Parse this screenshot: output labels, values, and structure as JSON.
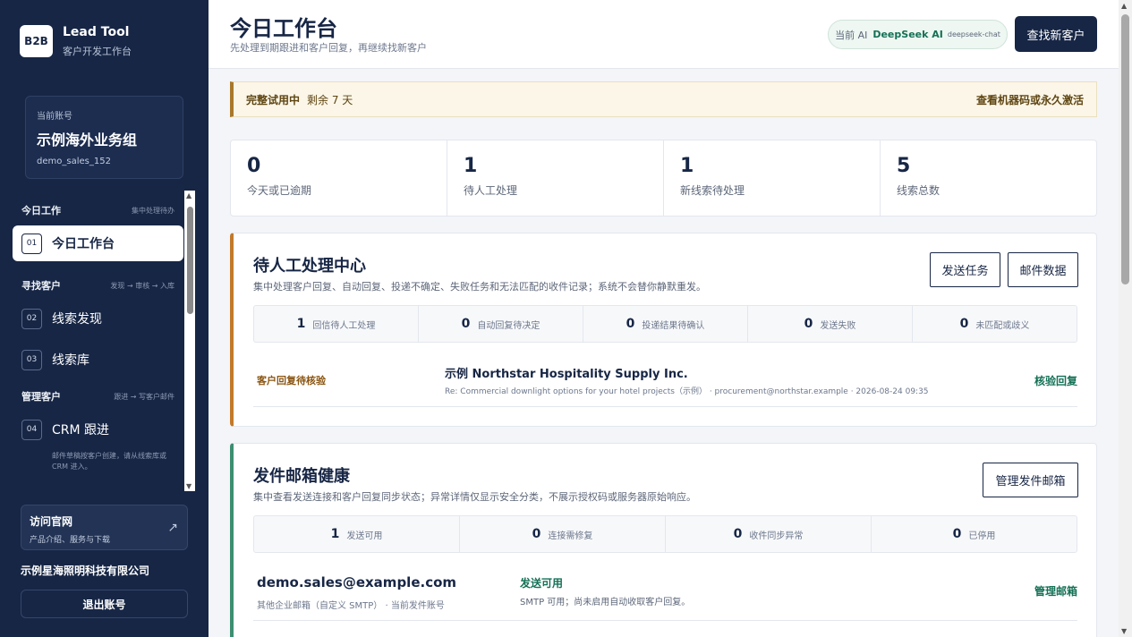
{
  "brand": {
    "logo": "B2B",
    "name": "Lead Tool",
    "subtitle": "客户开发工作台"
  },
  "account": {
    "label": "当前账号",
    "name": "示例海外业务组",
    "id": "demo_sales_152"
  },
  "nav": {
    "groups": [
      {
        "title": "今日工作",
        "hint": "集中处理待办"
      },
      {
        "title": "寻找客户",
        "hint": "发现 → 审核 → 入库"
      },
      {
        "title": "管理客户",
        "hint": "跟进 → 写客户邮件"
      }
    ],
    "items": [
      {
        "num": "01",
        "label": "今日工作台"
      },
      {
        "num": "02",
        "label": "线索发现"
      },
      {
        "num": "03",
        "label": "线索库"
      },
      {
        "num": "04",
        "label": "CRM 跟进"
      }
    ],
    "note": "邮件草稿按客户创建，请从线索库或 CRM 进入。"
  },
  "visit": {
    "title": "访问官网",
    "subtitle": "产品介绍、服务与下载",
    "icon": "external-arrow-icon"
  },
  "company": "示例星海照明科技有限公司",
  "logout": "退出账号",
  "header": {
    "title": "今日工作台",
    "subtitle": "先处理到期跟进和客户回复，再继续找新客户",
    "ai_prefix": "当前 AI",
    "ai_name": "DeepSeek AI",
    "ai_model": "deepseek-chat",
    "find_button": "查找新客户"
  },
  "trial": {
    "title": "完整试用中",
    "days": "剩余 7 天",
    "link": "查看机器码或永久激活"
  },
  "stats": [
    {
      "value": "0",
      "label": "今天或已逾期"
    },
    {
      "value": "1",
      "label": "待人工处理"
    },
    {
      "value": "1",
      "label": "新线索待处理"
    },
    {
      "value": "5",
      "label": "线索总数"
    }
  ],
  "manual": {
    "title": "待人工处理中心",
    "subtitle": "集中处理客户回复、自动回复、投递不确定、失败任务和无法匹配的收件记录；系统不会替你静默重发。",
    "btn_tasks": "发送任务",
    "btn_mail": "邮件数据",
    "mini": [
      {
        "value": "1",
        "label": "回信待人工处理"
      },
      {
        "value": "0",
        "label": "自动回复待决定"
      },
      {
        "value": "0",
        "label": "投递结果待确认"
      },
      {
        "value": "0",
        "label": "发送失败"
      },
      {
        "value": "0",
        "label": "未匹配或歧义"
      }
    ],
    "row": {
      "tag": "客户回复待核验",
      "title": "示例 Northstar Hospitality Supply Inc.",
      "meta": "Re: Commercial downlight options for your hotel projects（示例） · procurement@northstar.example · 2026-08-24 09:35",
      "action": "核验回复"
    }
  },
  "mailbox": {
    "title": "发件邮箱健康",
    "subtitle": "集中查看发送连接和客户回复同步状态；异常详情仅显示安全分类，不展示授权码或服务器原始响应。",
    "btn_manage": "管理发件邮箱",
    "mini": [
      {
        "value": "1",
        "label": "发送可用"
      },
      {
        "value": "0",
        "label": "连接需修复"
      },
      {
        "value": "0",
        "label": "收件同步异常"
      },
      {
        "value": "0",
        "label": "已停用"
      }
    ],
    "row": {
      "address": "demo.sales@example.com",
      "meta": "其他企业邮箱（自定义 SMTP） · 当前发件账号",
      "status": "发送可用",
      "status_sub": "SMTP 可用；尚未启用自动收取客户回复。",
      "action": "管理邮箱"
    }
  }
}
